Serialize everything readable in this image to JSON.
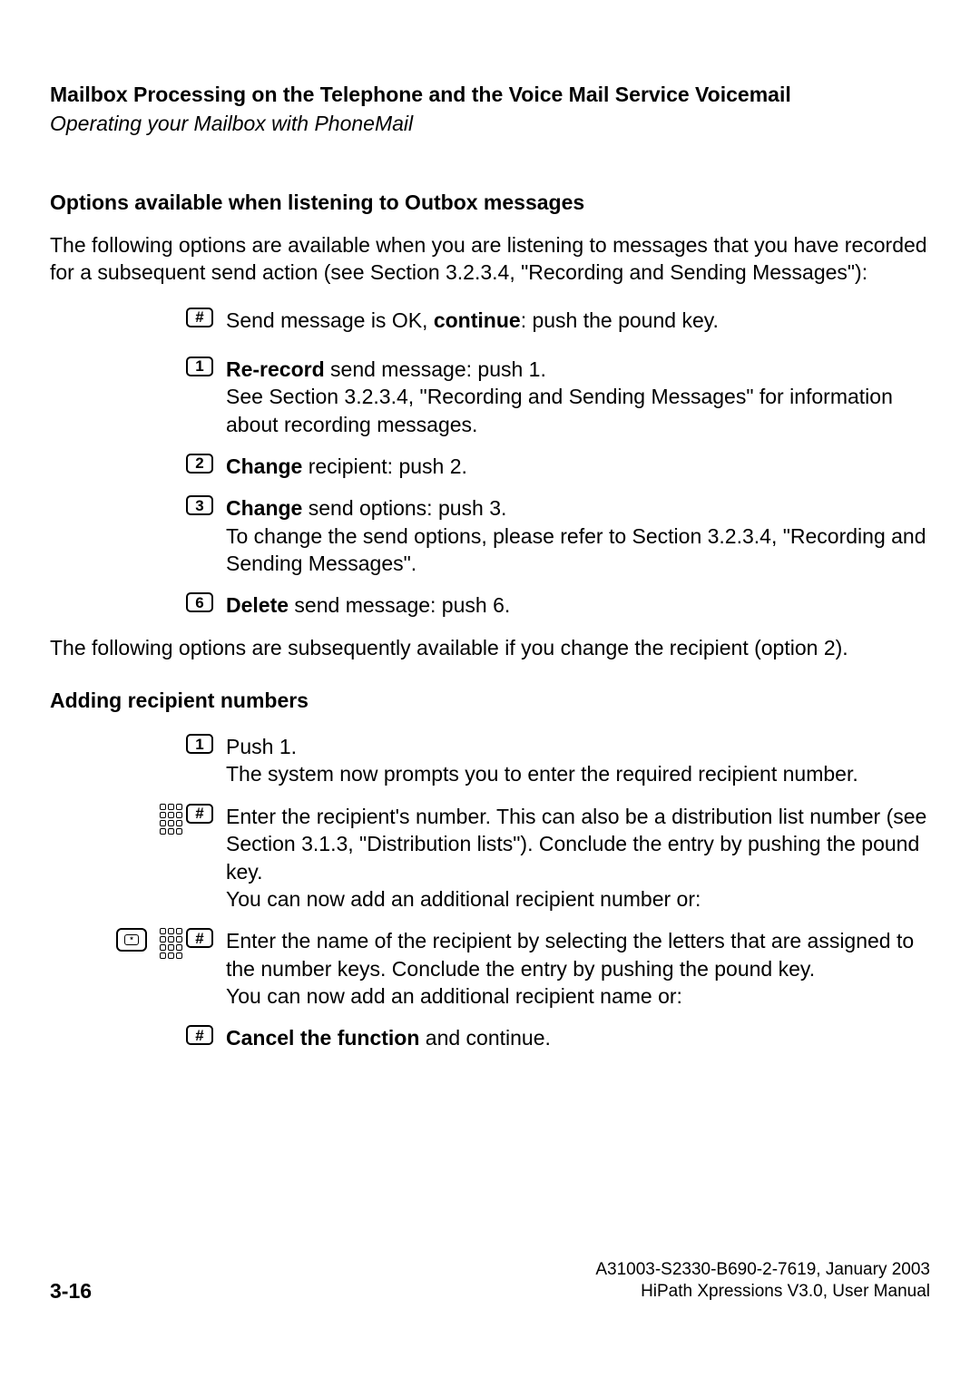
{
  "header": {
    "title": "Mailbox Processing on the Telephone and the Voice Mail Service Voicemail",
    "subtitle": "Operating your Mailbox with PhoneMail"
  },
  "section1": {
    "heading": "Options available when listening to Outbox messages",
    "intro": "The following options are available when you are listening to messages that you have recorded for a subsequent send action (see Section 3.2.3.4, \"Recording and Sending Messages\"):"
  },
  "opts": {
    "pound": {
      "key": "#",
      "t1": "Send message is OK, ",
      "b1": "continue",
      "t2": ": push the pound key."
    },
    "one": {
      "key": "1",
      "b1": "Re-record",
      "t1": " send message: push 1.",
      "t2": "See Section 3.2.3.4, \"Recording and Sending Messages\" for information about recording messages."
    },
    "two": {
      "key": "2",
      "b1": "Change",
      "t1": " recipient: push 2."
    },
    "three": {
      "key": "3",
      "b1": "Change",
      "t1": " send options: push 3.",
      "t2": "To change the send options, please refer to Section 3.2.3.4, \"Recording and Sending Messages\"."
    },
    "six": {
      "key": "6",
      "b1": "Delete",
      "t1": " send message: push 6."
    }
  },
  "midtext": "The following options are subsequently available if you change the recipient (option 2).",
  "section2": {
    "heading": "Adding recipient numbers"
  },
  "opts2": {
    "one": {
      "key": "1",
      "t1": "Push 1.",
      "t2": "The system now prompts you to enter the required recipient number."
    },
    "poundA": {
      "key": "#",
      "t1": "Enter the recipient's number. This can also be a distribution list number (see Section 3.1.3, \"Distribution lists\"). Conclude the entry by pushing the pound key.",
      "t2": "You can now add an additional recipient number or:"
    },
    "poundB": {
      "key": "#",
      "t1": "Enter the name of the recipient by selecting the letters that are assigned to the number keys. Conclude the entry by pushing the pound key.",
      "t2": "You can now add an additional recipient name or:"
    },
    "poundC": {
      "key": "#",
      "b1": "Cancel the function",
      "t1": " and continue."
    },
    "star_inner": "*"
  },
  "footer": {
    "page": "3-16",
    "line1": "A31003-S2330-B690-2-7619, January 2003",
    "line2": "HiPath Xpressions V3.0, User Manual"
  }
}
